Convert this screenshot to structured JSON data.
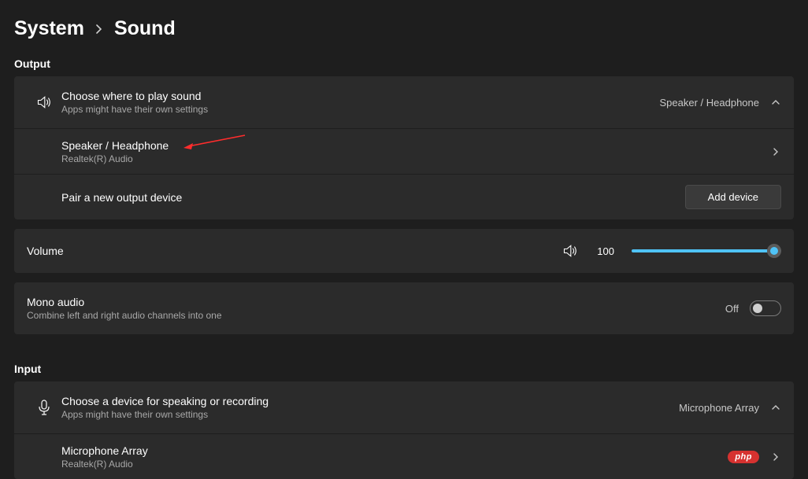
{
  "breadcrumb": {
    "parent": "System",
    "current": "Sound"
  },
  "output": {
    "header": "Output",
    "choose": {
      "title": "Choose where to play sound",
      "sub": "Apps might have their own settings",
      "selected": "Speaker / Headphone"
    },
    "device": {
      "title": "Speaker / Headphone",
      "sub": "Realtek(R) Audio"
    },
    "pair": {
      "title": "Pair a new output device",
      "button": "Add device"
    },
    "volume": {
      "label": "Volume",
      "value": "100"
    },
    "mono": {
      "title": "Mono audio",
      "sub": "Combine left and right audio channels into one",
      "state": "Off"
    }
  },
  "input": {
    "header": "Input",
    "choose": {
      "title": "Choose a device for speaking or recording",
      "sub": "Apps might have their own settings",
      "selected": "Microphone Array"
    },
    "device": {
      "title": "Microphone Array",
      "sub": "Realtek(R) Audio"
    },
    "badge": "php"
  }
}
